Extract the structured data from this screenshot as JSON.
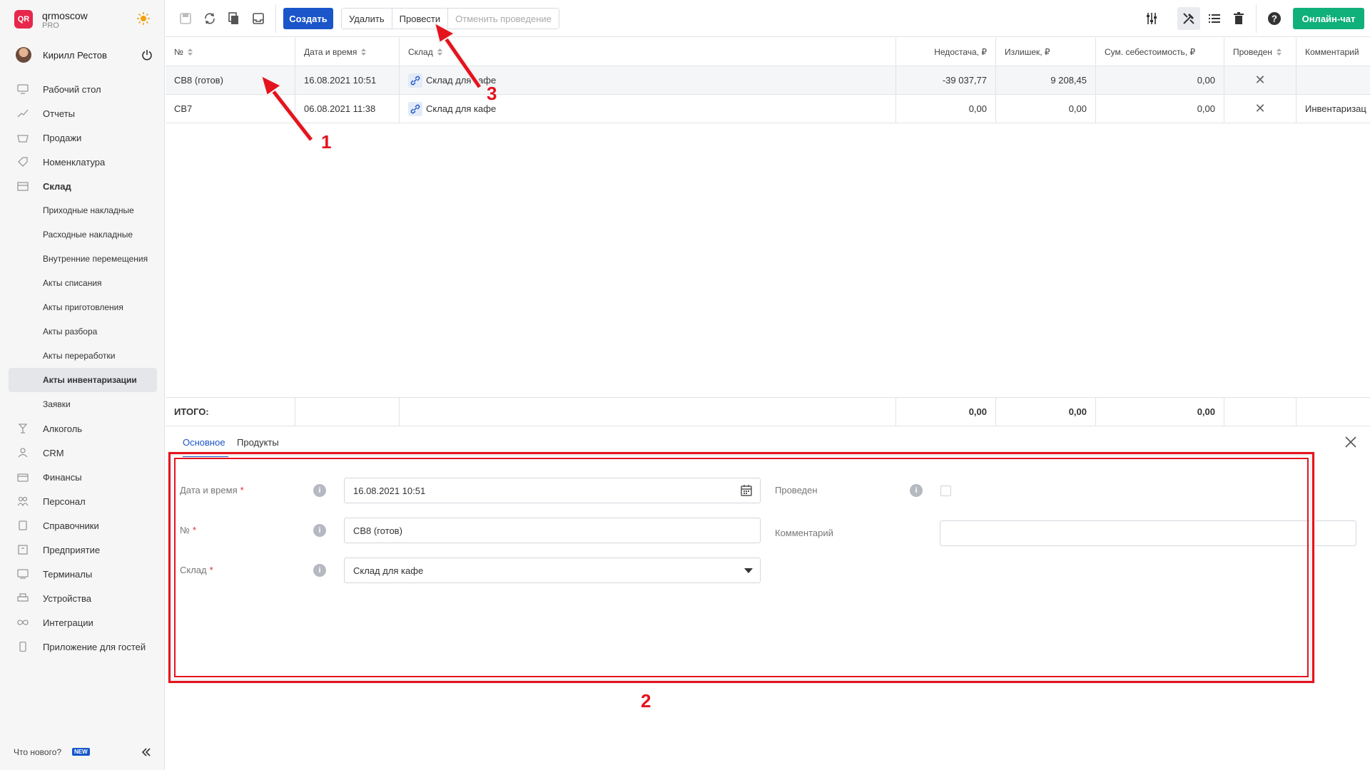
{
  "brand": {
    "name": "qrmoscow",
    "plan": "PRO",
    "logo_text": "QR"
  },
  "user": {
    "name": "Кирилл Рестов"
  },
  "sidebar": {
    "items": [
      {
        "label": "Рабочий стол",
        "icon": "desktop-icon"
      },
      {
        "label": "Отчеты",
        "icon": "chart-icon"
      },
      {
        "label": "Продажи",
        "icon": "basket-icon"
      },
      {
        "label": "Номенклатура",
        "icon": "tag-icon"
      },
      {
        "label": "Склад",
        "icon": "warehouse-icon"
      },
      {
        "label": "Приходные накладные"
      },
      {
        "label": "Расходные накладные"
      },
      {
        "label": "Внутренние перемещения"
      },
      {
        "label": "Акты списания"
      },
      {
        "label": "Акты приготовления"
      },
      {
        "label": "Акты разбора"
      },
      {
        "label": "Акты переработки"
      },
      {
        "label": "Акты инвентаризации"
      },
      {
        "label": "Заявки"
      },
      {
        "label": "Алкоголь",
        "icon": "glass-icon"
      },
      {
        "label": "CRM",
        "icon": "people-icon"
      },
      {
        "label": "Финансы",
        "icon": "wallet-icon"
      },
      {
        "label": "Персонал",
        "icon": "staff-icon"
      },
      {
        "label": "Справочники",
        "icon": "book-icon"
      },
      {
        "label": "Предприятие",
        "icon": "building-icon"
      },
      {
        "label": "Терминалы",
        "icon": "terminal-icon"
      },
      {
        "label": "Устройства",
        "icon": "printer-icon"
      },
      {
        "label": "Интеграции",
        "icon": "infinity-icon"
      },
      {
        "label": "Приложение для гостей",
        "icon": "phone-icon"
      }
    ],
    "whats_new": "Что нового?",
    "new_badge": "NEW"
  },
  "toolbar": {
    "create": "Создать",
    "delete": "Удалить",
    "post": "Провести",
    "unpost": "Отменить проведение",
    "chat": "Онлайн-чат"
  },
  "table": {
    "columns": [
      "№",
      "Дата и время",
      "Склад",
      "Недостача, ₽",
      "Излишек, ₽",
      "Сум. себестоимость, ₽",
      "Проведен",
      "Комментарий"
    ],
    "rows": [
      {
        "no": "СВ8 (готов)",
        "date": "16.08.2021 10:51",
        "warehouse": "Склад для кафе",
        "shortage": "-39 037,77",
        "surplus": "9 208,45",
        "cost": "0,00",
        "posted": "✕",
        "comment": ""
      },
      {
        "no": "СВ7",
        "date": "06.08.2021 11:38",
        "warehouse": "Склад для кафе",
        "shortage": "0,00",
        "surplus": "0,00",
        "cost": "0,00",
        "posted": "✕",
        "comment": "Инвентаризац"
      }
    ],
    "totals": {
      "label": "ИТОГО:",
      "shortage": "0,00",
      "surplus": "0,00",
      "cost": "0,00"
    }
  },
  "panel": {
    "tabs": [
      "Основное",
      "Продукты"
    ],
    "fields": {
      "date_label": "Дата и время",
      "date_value": "16.08.2021 10:51",
      "no_label": "№",
      "no_value": "СВ8 (готов)",
      "warehouse_label": "Склад",
      "warehouse_value": "Склад для кафе",
      "posted_label": "Проведен",
      "comment_label": "Комментарий",
      "required_mark": "*",
      "info_glyph": "i"
    }
  },
  "annotations": [
    "1",
    "2",
    "3"
  ],
  "colors": {
    "primary": "#1a55c9",
    "chat": "#10b07a",
    "annotation": "#e5131d",
    "logo": "#e7274b"
  }
}
